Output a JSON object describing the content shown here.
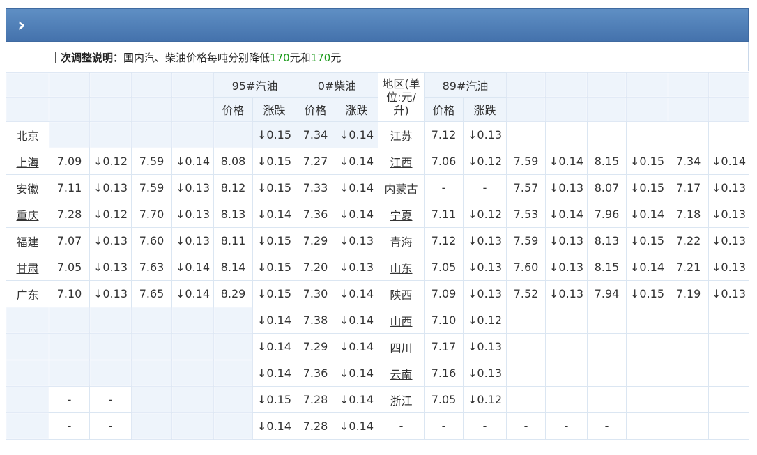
{
  "header": {
    "chevron": "chevron-right-icon"
  },
  "notice": {
    "title": "次调整说明：",
    "text1": "国内汽、柴油价格每吨分别降低",
    "num1": "170",
    "text2": "元和",
    "num2": "170",
    "text3": "元"
  },
  "table": {
    "group_headers": [
      "95#汽油",
      "0#柴油",
      "地区(单位:元/升)",
      "89#汽油"
    ],
    "sub_headers": [
      "价格",
      "涨跌",
      "价格",
      "涨跌",
      "价格",
      "涨跌"
    ],
    "rows": [
      [
        "北京",
        "",
        "",
        "",
        "",
        "",
        "↓0.15",
        "7.34",
        "↓0.14",
        "江苏",
        "7.12",
        "↓0.13",
        "",
        "",
        "",
        "",
        "",
        ""
      ],
      [
        "上海",
        "7.09",
        "↓0.12",
        "7.59",
        "↓0.14",
        "8.08",
        "↓0.15",
        "7.27",
        "↓0.14",
        "江西",
        "7.06",
        "↓0.12",
        "7.59",
        "↓0.14",
        "8.15",
        "↓0.15",
        "7.34",
        "↓0.14"
      ],
      [
        "安徽",
        "7.11",
        "↓0.13",
        "7.59",
        "↓0.13",
        "8.12",
        "↓0.15",
        "7.33",
        "↓0.14",
        "内蒙古",
        "-",
        "-",
        "7.57",
        "↓0.13",
        "8.07",
        "↓0.15",
        "7.17",
        "↓0.13"
      ],
      [
        "重庆",
        "7.28",
        "↓0.12",
        "7.70",
        "↓0.13",
        "8.13",
        "↓0.14",
        "7.36",
        "↓0.14",
        "宁夏",
        "7.11",
        "↓0.12",
        "7.53",
        "↓0.14",
        "7.96",
        "↓0.14",
        "7.18",
        "↓0.13"
      ],
      [
        "福建",
        "7.07",
        "↓0.13",
        "7.60",
        "↓0.13",
        "8.11",
        "↓0.15",
        "7.29",
        "↓0.13",
        "青海",
        "7.12",
        "↓0.13",
        "7.59",
        "↓0.13",
        "8.13",
        "↓0.15",
        "7.22",
        "↓0.13"
      ],
      [
        "甘肃",
        "7.05",
        "↓0.13",
        "7.63",
        "↓0.14",
        "8.14",
        "↓0.15",
        "7.20",
        "↓0.13",
        "山东",
        "7.05",
        "↓0.13",
        "7.60",
        "↓0.13",
        "8.15",
        "↓0.14",
        "7.21",
        "↓0.13"
      ],
      [
        "广东",
        "7.10",
        "↓0.13",
        "7.65",
        "↓0.14",
        "8.29",
        "↓0.15",
        "7.30",
        "↓0.14",
        "陕西",
        "7.09",
        "↓0.13",
        "7.52",
        "↓0.13",
        "7.94",
        "↓0.15",
        "7.19",
        "↓0.13"
      ],
      [
        "",
        "",
        "",
        "",
        "",
        "",
        "↓0.14",
        "7.38",
        "↓0.14",
        "山西",
        "7.10",
        "↓0.12",
        "",
        "",
        "",
        "",
        "",
        ""
      ],
      [
        "",
        "",
        "",
        "",
        "",
        "",
        "↓0.14",
        "7.29",
        "↓0.14",
        "四川",
        "7.17",
        "↓0.13",
        "",
        "",
        "",
        "",
        "",
        ""
      ],
      [
        "",
        "",
        "",
        "",
        "",
        "",
        "↓0.14",
        "7.36",
        "↓0.14",
        "云南",
        "7.16",
        "↓0.13",
        "",
        "",
        "",
        "",
        "",
        ""
      ],
      [
        "",
        "-",
        "-",
        "",
        "",
        "",
        "↓0.15",
        "7.28",
        "↓0.14",
        "浙江",
        "7.05",
        "↓0.12",
        "",
        "",
        "",
        "",
        "",
        ""
      ],
      [
        "",
        "-",
        "-",
        "",
        "",
        "",
        "↓0.14",
        "7.28",
        "↓0.14",
        "-",
        "-",
        "-",
        "-",
        "-",
        "-",
        "",
        "",
        ""
      ]
    ]
  }
}
